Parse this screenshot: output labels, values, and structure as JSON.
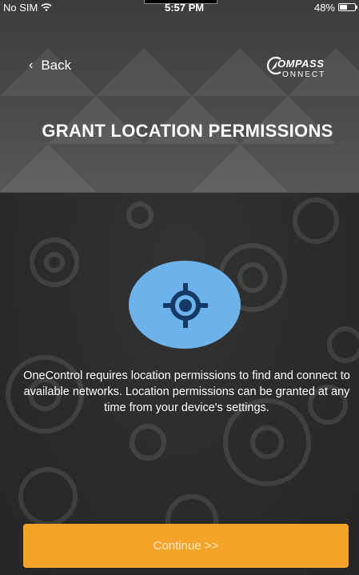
{
  "status_bar": {
    "carrier": "No SIM",
    "time": "5:57 PM",
    "battery_percent": "48%",
    "battery_level": 0.48
  },
  "header": {
    "back_label": "Back",
    "title": "GRANT LOCATION PERMISSIONS",
    "logo_line1": "OMPASS",
    "logo_line2": "ONNECT"
  },
  "main": {
    "description": "OneControl requires location permissions to find and connect to available networks. Location permissions can be granted at any time from your device's settings.",
    "icon_name": "location-crosshair-icon"
  },
  "footer": {
    "continue_label": "Continue >>"
  },
  "colors": {
    "accent": "#f5a42a",
    "icon_circle": "#6bb3ea",
    "icon_fg": "#153a66",
    "background": "#2f2f2f"
  }
}
